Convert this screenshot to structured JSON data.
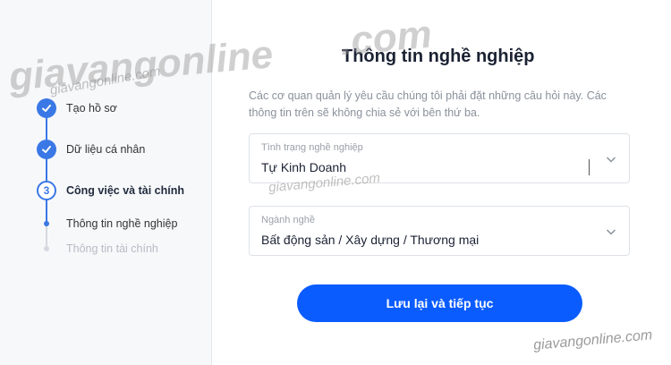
{
  "steps": [
    {
      "label": "Tạo hồ sơ",
      "state": "done"
    },
    {
      "label": "Dữ liệu cá nhân",
      "state": "done"
    },
    {
      "number": "3",
      "label": "Công việc và tài chính",
      "state": "current"
    },
    {
      "label": "Thông tin nghề nghiệp",
      "state": "sub-active"
    },
    {
      "label": "Thông tin tài chính",
      "state": "sub-inactive"
    }
  ],
  "main": {
    "title": "Thông tin nghề nghiệp",
    "description": "Các cơ quan quản lý yêu cầu chúng tôi phải đặt những câu hỏi này. Các thông tin trên sẽ không chia sẻ với bên thứ ba.",
    "fields": [
      {
        "label": "Tình trạng nghề nghiệp",
        "value": "Tự Kinh Doanh"
      },
      {
        "label": "Ngành nghề",
        "value": "Bất động sản / Xây dựng / Thương mại"
      }
    ],
    "submit_label": "Lưu lại và tiếp tục"
  },
  "watermark": {
    "big": "giavangonline",
    "big2": ".com",
    "small": "giavangonline.com"
  },
  "colors": {
    "accent": "#3a78e6",
    "button": "#0b5cff"
  },
  "icons": {
    "check": "check-icon",
    "chevron": "chevron-down-icon"
  }
}
